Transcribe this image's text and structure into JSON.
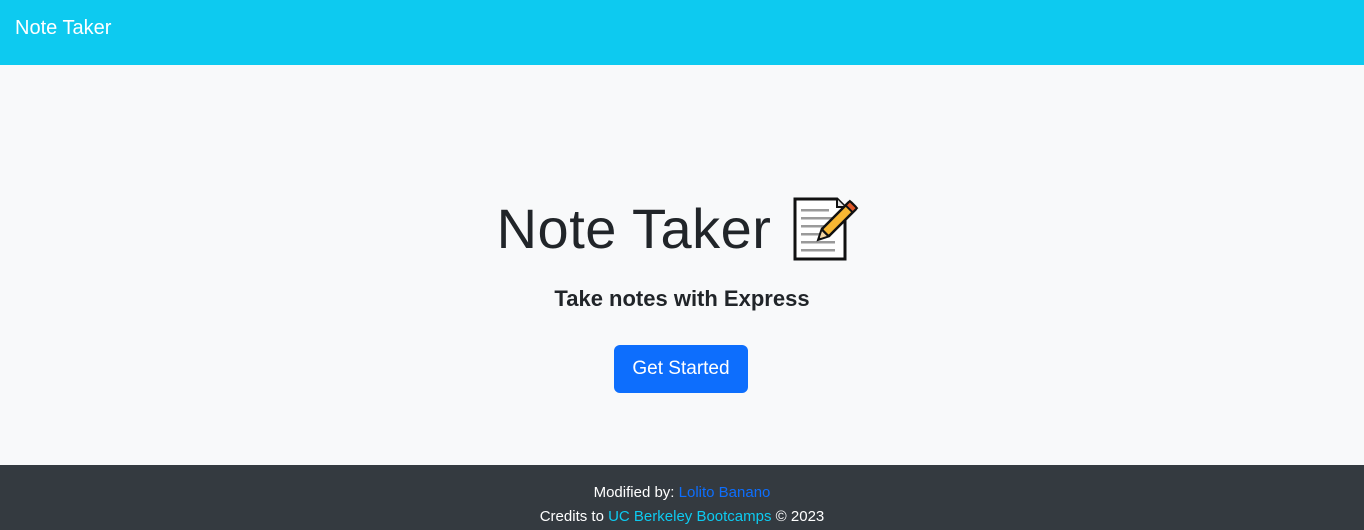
{
  "navbar": {
    "brand": "Note Taker",
    "color": "#0dcaf0"
  },
  "hero": {
    "title": "Note Taker",
    "title_icon": "memo-icon",
    "subtitle": "Take notes with Express",
    "button_label": "Get Started",
    "button_color": "#0d6efd"
  },
  "footer": {
    "modified_prefix": "Modified by:",
    "author_name": "Lolito Banano",
    "credits_prefix": "Credits to",
    "credits_name": "UC Berkeley Bootcamps",
    "copyright": "© 2023",
    "background": "#343a40"
  }
}
